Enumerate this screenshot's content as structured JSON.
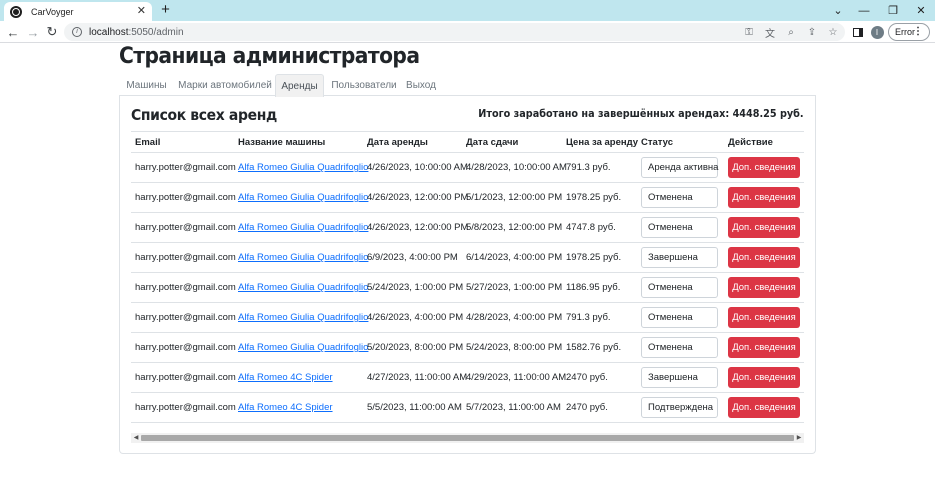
{
  "browser": {
    "tab_title": "CarVoyger",
    "url_host": "localhost",
    "url_path": ":5050/admin",
    "error_label": "Error",
    "profile_initial": "I"
  },
  "page": {
    "title": "Страница администратора",
    "nav_tabs": [
      {
        "label": "Машины",
        "active": false
      },
      {
        "label": "Марки автомобилей",
        "active": false
      },
      {
        "label": "Аренды",
        "active": true
      },
      {
        "label": "Пользователи",
        "active": false
      },
      {
        "label": "Выход",
        "active": false
      }
    ],
    "section_title": "Список всех аренд",
    "total_earned": "Итого заработано на завершённых арендах: 4448.25 руб.",
    "table": {
      "headers": [
        "Email",
        "Название машины",
        "Дата аренды",
        "Дата сдачи",
        "Цена за аренду",
        "Статус",
        "Действие"
      ],
      "action_label": "Доп. сведения",
      "rows": [
        {
          "email": "harry.potter@gmail.com",
          "car": "Alfa Romeo Giulia Quadrifoglio",
          "start": "4/26/2023, 10:00:00 AM",
          "end": "4/28/2023, 10:00:00 AM",
          "price": "791.3 руб.",
          "status": "Аренда активна"
        },
        {
          "email": "harry.potter@gmail.com",
          "car": "Alfa Romeo Giulia Quadrifoglio",
          "start": "4/26/2023, 12:00:00 PM",
          "end": "5/1/2023, 12:00:00 PM",
          "price": "1978.25 руб.",
          "status": "Отменена"
        },
        {
          "email": "harry.potter@gmail.com",
          "car": "Alfa Romeo Giulia Quadrifoglio",
          "start": "4/26/2023, 12:00:00 PM",
          "end": "5/8/2023, 12:00:00 PM",
          "price": "4747.8 руб.",
          "status": "Отменена"
        },
        {
          "email": "harry.potter@gmail.com",
          "car": "Alfa Romeo Giulia Quadrifoglio",
          "start": "6/9/2023, 4:00:00 PM",
          "end": "6/14/2023, 4:00:00 PM",
          "price": "1978.25 руб.",
          "status": "Завершена"
        },
        {
          "email": "harry.potter@gmail.com",
          "car": "Alfa Romeo Giulia Quadrifoglio",
          "start": "5/24/2023, 1:00:00 PM",
          "end": "5/27/2023, 1:00:00 PM",
          "price": "1186.95 руб.",
          "status": "Отменена"
        },
        {
          "email": "harry.potter@gmail.com",
          "car": "Alfa Romeo Giulia Quadrifoglio",
          "start": "4/26/2023, 4:00:00 PM",
          "end": "4/28/2023, 4:00:00 PM",
          "price": "791.3 руб.",
          "status": "Отменена"
        },
        {
          "email": "harry.potter@gmail.com",
          "car": "Alfa Romeo Giulia Quadrifoglio",
          "start": "5/20/2023, 8:00:00 PM",
          "end": "5/24/2023, 8:00:00 PM",
          "price": "1582.76 руб.",
          "status": "Отменена"
        },
        {
          "email": "harry.potter@gmail.com",
          "car": "Alfa Romeo 4C Spider",
          "start": "4/27/2023, 11:00:00 AM",
          "end": "4/29/2023, 11:00:00 AM",
          "price": "2470 руб.",
          "status": "Завершена"
        },
        {
          "email": "harry.potter@gmail.com",
          "car": "Alfa Romeo 4C Spider",
          "start": "5/5/2023, 11:00:00 AM",
          "end": "5/7/2023, 11:00:00 AM",
          "price": "2470 руб.",
          "status": "Подтверждена"
        }
      ]
    }
  },
  "colors": {
    "tabstrip": "#bfe6ee",
    "link": "#0d6efd",
    "danger_button": "#dc3545"
  },
  "icons": {
    "favicon": "globe-icon",
    "back": "arrow-left-icon",
    "forward": "arrow-right-icon",
    "reload": "reload-icon",
    "site_info": "info-icon",
    "key": "key-icon",
    "translate": "translate-icon",
    "zoom": "zoom-icon",
    "share": "share-icon",
    "bookmark": "star-icon"
  }
}
